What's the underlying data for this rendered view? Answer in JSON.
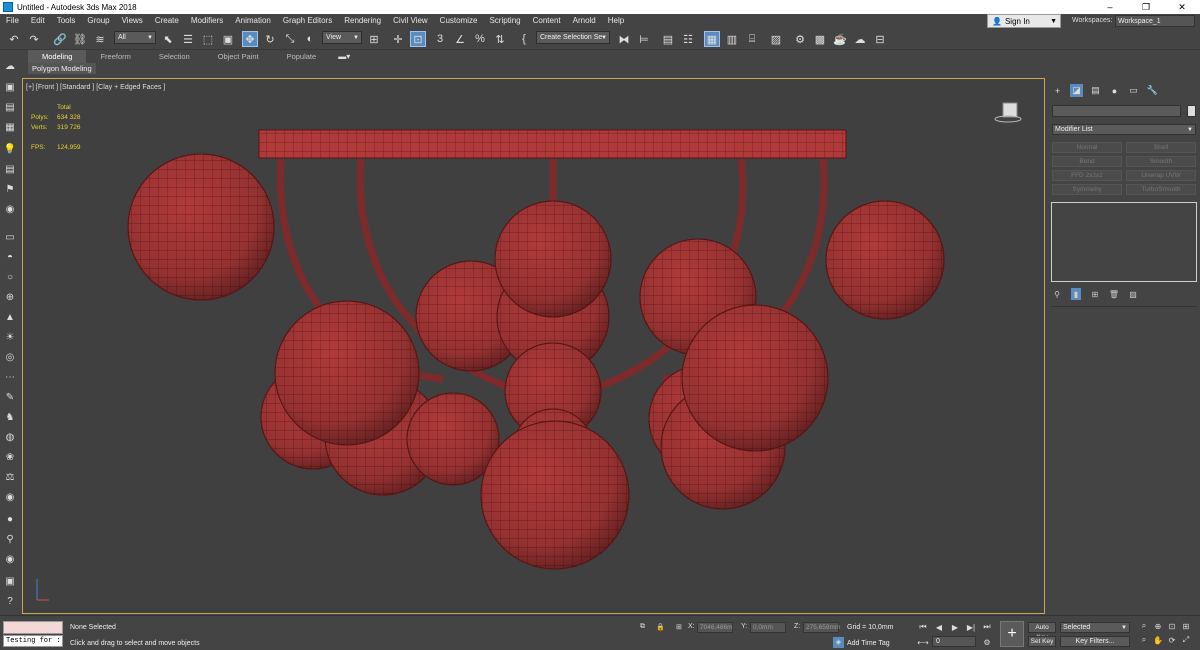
{
  "window": {
    "title": "Untitled - Autodesk 3ds Max 2018"
  },
  "menu": [
    "File",
    "Edit",
    "Tools",
    "Group",
    "Views",
    "Create",
    "Modifiers",
    "Animation",
    "Graph Editors",
    "Rendering",
    "Civil View",
    "Customize",
    "Scripting",
    "Content",
    "Arnold",
    "Help"
  ],
  "account": {
    "sign_in": "Sign In",
    "workspaces_label": "Workspaces:",
    "workspace": "Workspace_1"
  },
  "toolbar": {
    "selection_filter": "All",
    "ref_coord": "View",
    "named_selection": "Create Selection Se",
    "snap_label": "3",
    "snap_percent": "%"
  },
  "ribbon": {
    "tabs": [
      "Modeling",
      "Freeform",
      "Selection",
      "Object Paint",
      "Populate"
    ],
    "sub": "Polygon Modeling"
  },
  "viewport": {
    "label": "[+] [Front ] [Standard ] [Clay + Edged Faces ]",
    "stats": {
      "total": "Total",
      "polys_label": "Polys:",
      "polys": "634 328",
      "verts_label": "Verts:",
      "verts": "319 726",
      "fps_label": "FPS:",
      "fps": "124,959"
    },
    "model_color": "#b03a3a",
    "wire_color": "#6a1a1a"
  },
  "command_panel": {
    "modifier_list": "Modifier List",
    "modifiers": [
      "Normal",
      "Shell",
      "Bend",
      "Smooth",
      "FFD 2x2x2",
      "Unwrap UVW",
      "Symmetry",
      "TurboSmooth"
    ]
  },
  "status": {
    "script_input": "Testing for :",
    "selection": "None Selected",
    "prompt": "Click and drag to select and move objects",
    "x_label": "X:",
    "x_value": "7046,486m",
    "y_label": "Y:",
    "y_value": "0,0mm",
    "z_label": "Z:",
    "z_value": "275,659mm",
    "grid": "Grid = 10,0mm",
    "add_time_tag": "Add Time Tag",
    "frame": "0",
    "auto_key": "Auto Key",
    "set_key": "Set Key",
    "key_mode": "Selected",
    "key_filters": "Key Filters..."
  }
}
